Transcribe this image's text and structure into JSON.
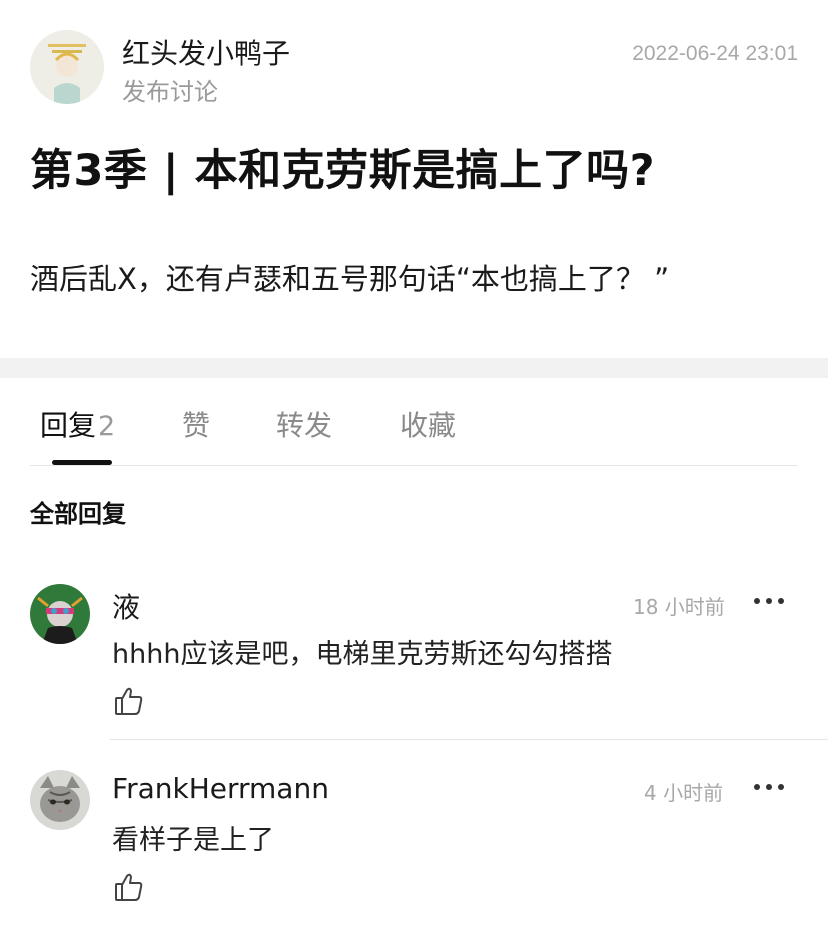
{
  "post": {
    "author": "红头发小鸭子",
    "action": "发布讨论",
    "timestamp": "2022-06-24 23:01",
    "title": "第3季 | 本和克劳斯是搞上了吗?",
    "body": "酒后乱X，还有卢瑟和五号那句话“本也搞上了？ ”"
  },
  "tabs": [
    {
      "label": "回复",
      "count": "2",
      "active": true
    },
    {
      "label": "赞"
    },
    {
      "label": "转发"
    },
    {
      "label": "收藏"
    }
  ],
  "section_label": "全部回复",
  "comments": [
    {
      "author": "液",
      "time": "18 小时前",
      "text": "hhhh应该是吧，电梯里克劳斯还勾勾搭搭",
      "like_icon": "thumbs-up-icon",
      "more_icon": "more-dots-icon"
    },
    {
      "author": "FrankHerrmann",
      "time": "4 小时前",
      "text": "看样子是上了",
      "like_icon": "thumbs-up-icon",
      "more_icon": "more-dots-icon"
    }
  ]
}
